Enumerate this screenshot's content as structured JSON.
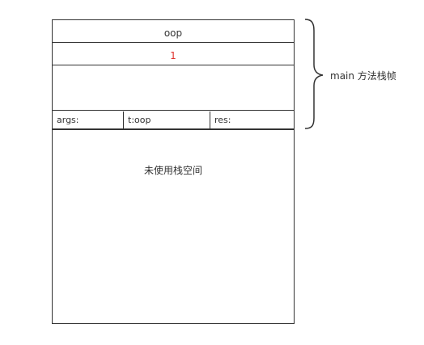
{
  "stack": {
    "rows": [
      {
        "text": "oop",
        "color": "#333333"
      },
      {
        "text": "1",
        "color": "#e0342f"
      }
    ],
    "cells": [
      "args:",
      "t:oop",
      "res:"
    ],
    "unused_label": "未使用栈空间"
  },
  "frame": {
    "label": "main 方法栈帧"
  }
}
